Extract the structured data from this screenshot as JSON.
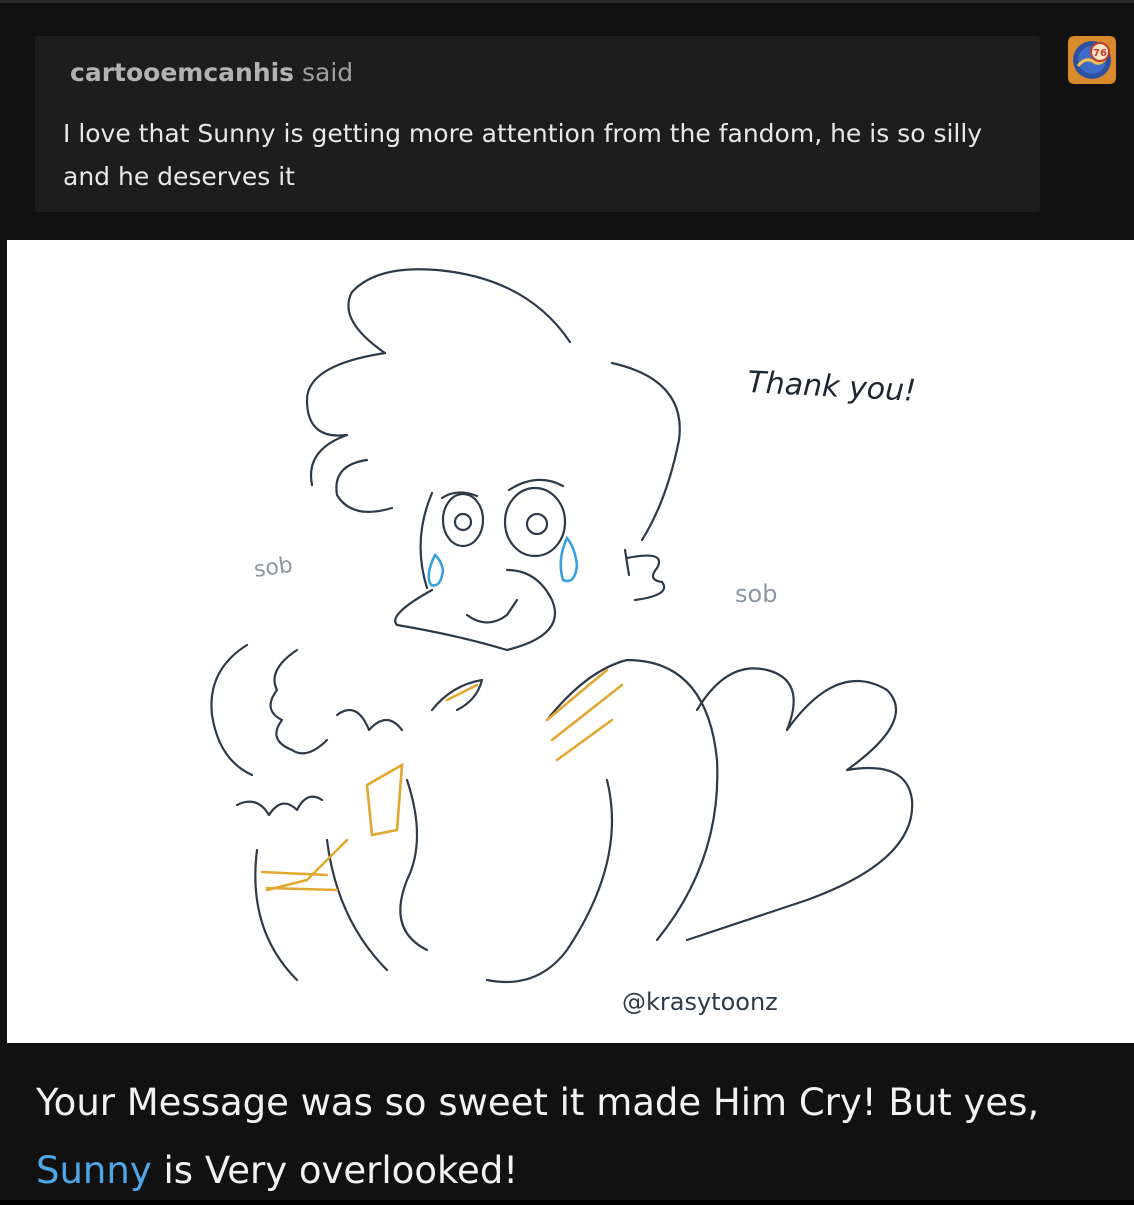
{
  "ask": {
    "asker": "cartooemcanhis",
    "said": "said",
    "question": "I love that Sunny is getting more attention from the fandom, he is so silly and he deserves it"
  },
  "avatar": {
    "icon": "avatar-badge-icon",
    "badge_text": "76"
  },
  "drawing": {
    "thank_you": "Thank you!",
    "sob_left": "sob",
    "sob_right": "sob",
    "signature": "@krasytoonz"
  },
  "answer": {
    "part1": "Your Message was so sweet it made Him Cry! But yes,",
    "link": "Sunny",
    "part2": "is Very overlooked!"
  },
  "colors": {
    "background": "#111111",
    "ask_box": "#1d1d1d",
    "link": "#4ea6e6",
    "sketch_line": "#2f3a48",
    "tears": "#3aa0e0",
    "gold": "#e0a830"
  }
}
